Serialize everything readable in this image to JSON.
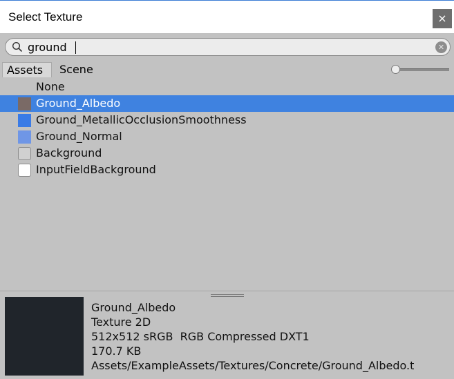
{
  "window": {
    "title": "Select Texture",
    "close_label": "×"
  },
  "search": {
    "value": "ground"
  },
  "tabs": [
    {
      "label": "Assets"
    },
    {
      "label": "Scene"
    }
  ],
  "zoom_slider": {
    "value": 0.0
  },
  "items": [
    {
      "label": "None",
      "swatch": null
    },
    {
      "label": "Ground_Albedo",
      "swatch": "#7a6a66"
    },
    {
      "label": "Ground_MetallicOcclusionSmoothness",
      "swatch": "#3a7be6"
    },
    {
      "label": "Ground_Normal",
      "swatch": "#6f96e6"
    },
    {
      "label": "Background",
      "swatch": "#d0d0d0"
    },
    {
      "label": "InputFieldBackground",
      "swatch": "#ffffff"
    }
  ],
  "selected_index": 1,
  "details": {
    "name": "Ground_Albedo",
    "type": "Texture 2D",
    "format": "512x512 sRGB  RGB Compressed DXT1",
    "size": "170.7 KB",
    "path": "Assets/ExampleAssets/Textures/Concrete/Ground_Albedo.t"
  },
  "colors": {
    "selection": "#3f82e0",
    "preview": "#20252b"
  }
}
